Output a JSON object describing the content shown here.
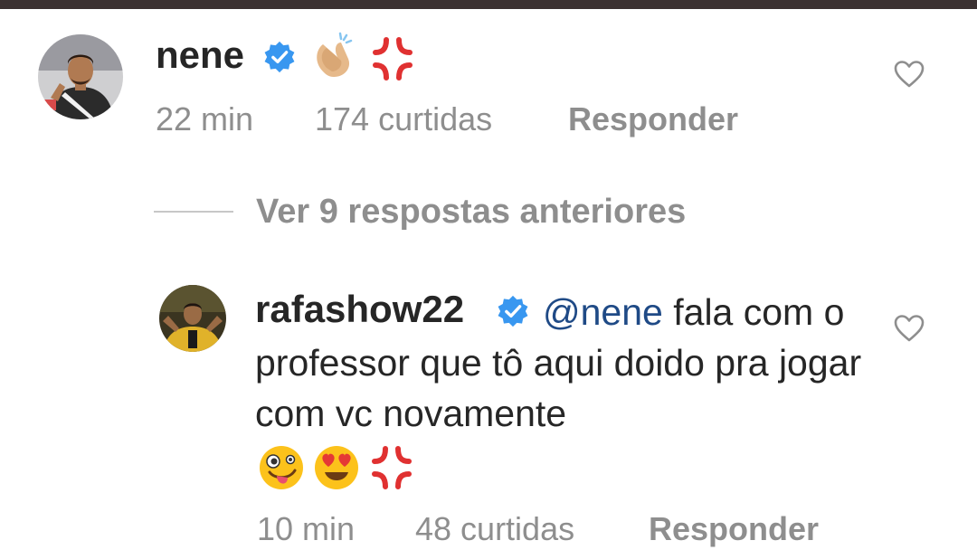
{
  "colors": {
    "verified_blue": "#3897f0",
    "meta_gray": "#8e8e8e",
    "mention_blue": "#1f4a86",
    "topbar": "#3b3131"
  },
  "comments": [
    {
      "username": "nene",
      "verified": true,
      "text": "",
      "emojis": [
        "👏🏼",
        "💢"
      ],
      "time": "22 min",
      "likes": "174 curtidas",
      "reply_label": "Responder",
      "like_icon": "heart-outline-icon"
    }
  ],
  "replies_toggle": "Ver 9 respostas anteriores",
  "replies": [
    {
      "username": "rafashow22",
      "verified": true,
      "mention": "@nene",
      "text": "fala com o professor que tô aqui doido pra jogar com vc novamente",
      "emojis": [
        "🤪",
        "😍",
        "💢"
      ],
      "time": "10 min",
      "likes": "48 curtidas",
      "reply_label": "Responder",
      "like_icon": "heart-outline-icon"
    }
  ]
}
